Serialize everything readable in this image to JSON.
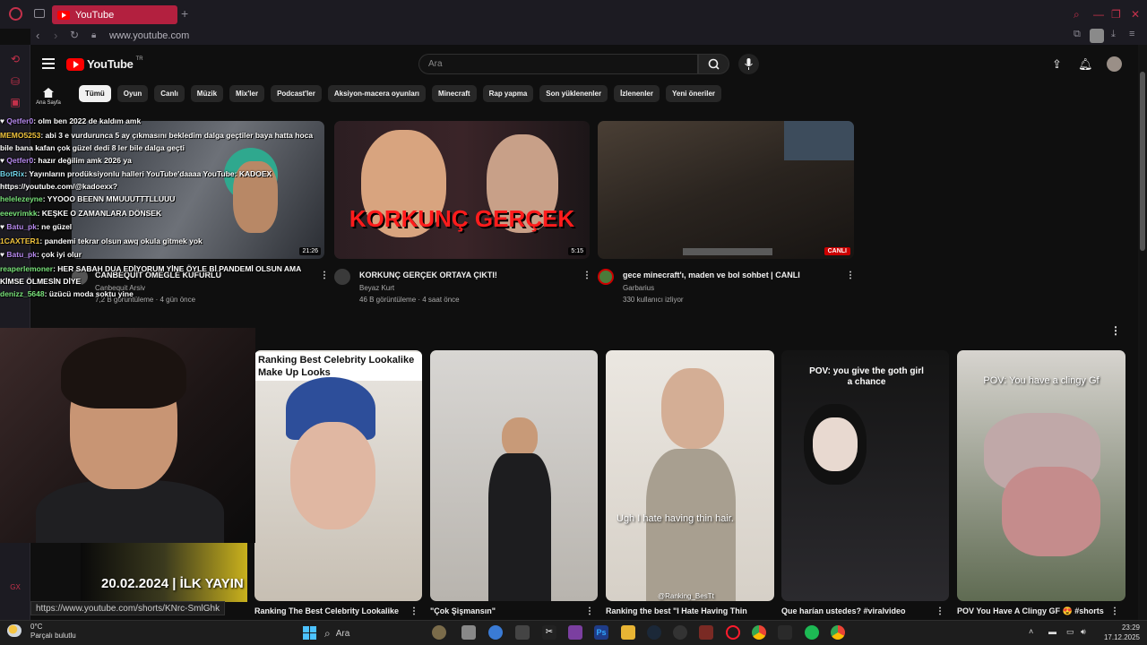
{
  "browser": {
    "tab_title": "YouTube",
    "url": "www.youtube.com",
    "status_url": "https://www.youtube.com/shorts/KNrc-SmlGhk"
  },
  "youtube": {
    "logo_text": "YouTube",
    "logo_region": "TR",
    "search_placeholder": "Ara",
    "home_label": "Ana Sayfa",
    "chips": [
      "Tümü",
      "Oyun",
      "Canlı",
      "Müzik",
      "Mix'ler",
      "Podcast'ler",
      "Aksiyon-macera oyunları",
      "Minecraft",
      "Rap yapma",
      "Son yüklenenler",
      "İzlenenler",
      "Yeni öneriler"
    ],
    "videos": [
      {
        "title": "CANBEQUİT OMEGLE KÜFÜRLÜ",
        "channel": "Canbequit Arsiv",
        "meta": "7,2 B görüntüleme · 4 gün önce",
        "duration": "21:26"
      },
      {
        "title": "KORKUNÇ GERÇEK ORTAYA ÇIKTI!",
        "channel": "Beyaz Kurt",
        "meta": "46 B görüntüleme · 4 saat önce",
        "duration": "5:15",
        "thumb_text": "KORKUNÇ GERÇEK"
      },
      {
        "title": "gece minecraft'ı, maden ve bol sohbet | CANLI",
        "channel": "Garbarius",
        "meta": "330 kullanıcı izliyor",
        "badge": "CANLI"
      }
    ],
    "shorts": [
      {
        "title": "Ranking The Best Celebrity Lookalike",
        "overlay": "Ranking Best Celebrity Lookalike Make Up Looks"
      },
      {
        "title": "\"Çok Şişmansın\""
      },
      {
        "title": "Ranking the best \"I Hate Having Thin",
        "overlay": "Ugh I hate having thin hair.",
        "watermark": "@Ranking_BesTt"
      },
      {
        "title": "Que harían ustedes? #viralvideo",
        "overlay": "POV: you give the goth girl a chance"
      },
      {
        "title": "POV You Have A Clingy GF 😍 #shorts",
        "overlay": "POV: You have a clingy Gf"
      }
    ]
  },
  "stream": {
    "chat": [
      {
        "user": "Qetfer0",
        "text": ": olm ben 2022 de kaldım amk",
        "color": "u"
      },
      {
        "user": "MEMO5253",
        "text": ": abi 3 e vurdurunca 5 ay çıkmasını bekledim dalga geçtiler baya hatta hoca bile bana kafan çok güzel dedi 8 ler bile dalga geçti",
        "color": "o"
      },
      {
        "user": "Qetfer0",
        "text": ": hazır değilim amk 2026 ya",
        "color": "u"
      },
      {
        "user": "BotRix",
        "text": ": Yayınların prodüksiyonlu halleri YouTube'daaaa YouTube: KADOEX https://youtube.com/@kadoexx?",
        "color": "c"
      },
      {
        "user": "helelezeyne",
        "text": ": YYOOO BEENN MMUUUTTTLLUUU",
        "color": "g"
      },
      {
        "user": "eeevrimkk",
        "text": ": KEŞKE O ZAMANLARA DÖNSEK",
        "color": "g"
      },
      {
        "user": "Batu_pk",
        "text": ": ne güzel",
        "color": "u"
      },
      {
        "user": "1CAXTER1",
        "text": ": pandemi tekrar olsun awq okula gitmek yok",
        "color": "o"
      },
      {
        "user": "Batu_pk",
        "text": ": çok iyi olur",
        "color": "u"
      },
      {
        "user": "reaperlemoner",
        "text": ": HER SABAH DUA EDİYORUM YİNE ÖYLE Bİ PANDEMİ OLSUN AMA KİMSE ÖLMESİN DİYE",
        "color": "g"
      },
      {
        "user": "denizz_5648",
        "text": ": üzücü moda soktu yine",
        "color": "g"
      }
    ],
    "banner": "20.02.2024 | İLK YAYIN"
  },
  "taskbar": {
    "temperature": "0°C",
    "weather": "Parçalı bulutlu",
    "search": "Ara",
    "time": "23:29",
    "date": "17.12.2025"
  },
  "colors": {
    "accent": "#ff0000",
    "opera": "#b3203f"
  }
}
